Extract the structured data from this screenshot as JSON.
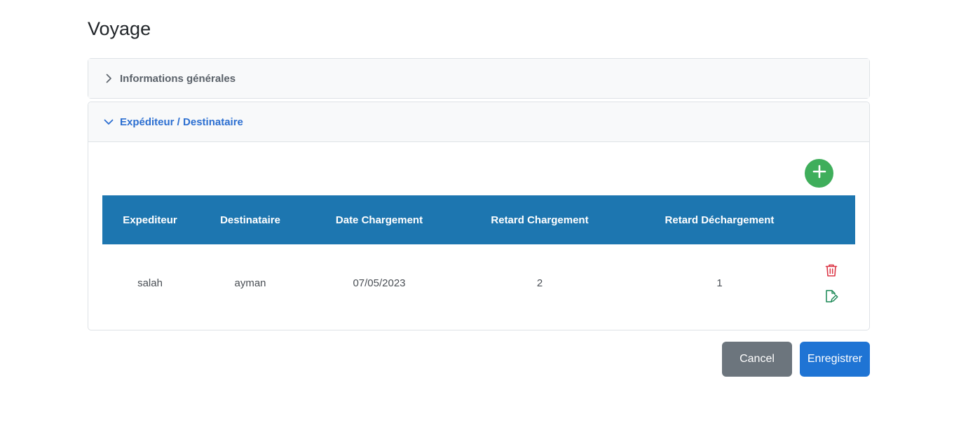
{
  "page": {
    "title": "Voyage"
  },
  "accordion": {
    "section1": {
      "label": "Informations générales",
      "expanded": false
    },
    "section2": {
      "label": "Expéditeur / Destinataire",
      "expanded": true
    }
  },
  "table": {
    "headers": [
      "Expediteur",
      "Destinataire",
      "Date Chargement",
      "Retard Chargement",
      "Retard Déchargement"
    ],
    "rows": [
      {
        "expediteur": "salah",
        "destinataire": "ayman",
        "date_chargement": "07/05/2023",
        "retard_chargement": "2",
        "retard_dechargement": "1"
      }
    ]
  },
  "icons": {
    "add": "plus-circle-icon",
    "delete": "trash-icon",
    "edit": "edit-document-icon"
  },
  "buttons": {
    "cancel": "Cancel",
    "save": "Enregistrer"
  },
  "colors": {
    "header_bg": "#1d76b0",
    "add_green": "#3fae5b",
    "delete_red": "#dc3545",
    "edit_green": "#198754",
    "cancel_gray": "#6c757d",
    "save_blue": "#1f74d4",
    "active_accordion": "#2c6fd1"
  }
}
